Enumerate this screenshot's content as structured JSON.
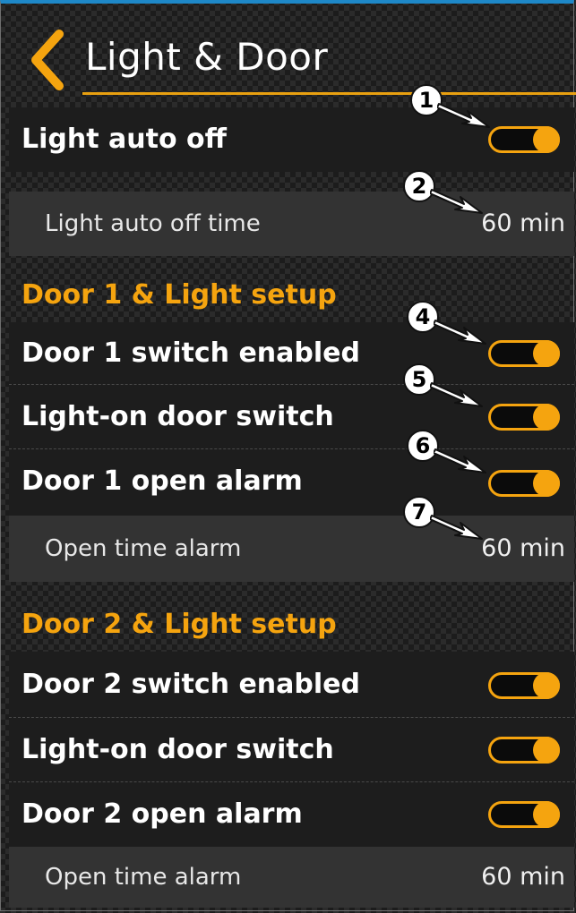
{
  "header": {
    "title": "Light & Door"
  },
  "light_auto_off": {
    "label": "Light auto off",
    "toggle_on": true,
    "time_label": "Light auto off time",
    "time_value": "60 min"
  },
  "door1": {
    "section_title": "Door 1 & Light setup",
    "switch_enabled_label": "Door 1 switch enabled",
    "light_on_switch_label": "Light-on door switch",
    "open_alarm_label": "Door 1 open alarm",
    "open_time_alarm_label": "Open time alarm",
    "open_time_alarm_value": "60 min"
  },
  "door2": {
    "section_title": "Door 2 & Light setup",
    "switch_enabled_label": "Door 2 switch enabled",
    "light_on_switch_label": "Light-on door switch",
    "open_alarm_label": "Door 2 open alarm",
    "open_time_alarm_label": "Open time alarm",
    "open_time_alarm_value": "60 min"
  },
  "callouts": [
    "1",
    "2",
    "4",
    "5",
    "6",
    "7"
  ],
  "colors": {
    "accent": "#f5a40f",
    "background": "#1c1c1c",
    "sub_row": "#333333",
    "top_bar": "#1e88c8"
  }
}
